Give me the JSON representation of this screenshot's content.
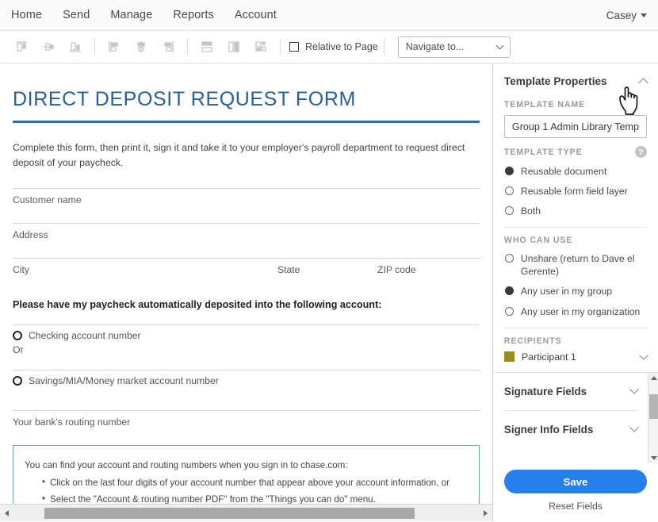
{
  "topnav": {
    "items": [
      {
        "label": "Home"
      },
      {
        "label": "Send"
      },
      {
        "label": "Manage"
      },
      {
        "label": "Reports"
      },
      {
        "label": "Account"
      }
    ],
    "user": "Casey"
  },
  "toolbar": {
    "icons": [
      {
        "name": "align-top-icon"
      },
      {
        "name": "align-middle-horizontal-icon"
      },
      {
        "name": "align-bottom-icon"
      },
      {
        "name": "align-left-icon"
      },
      {
        "name": "align-center-icon"
      },
      {
        "name": "align-right-icon"
      },
      {
        "name": "match-width-icon"
      },
      {
        "name": "match-height-icon"
      },
      {
        "name": "match-width-and-height-icon"
      }
    ],
    "relative_to_page_label": "Relative to Page",
    "relative_to_page_checked": false,
    "navigate_to_label": "Navigate to..."
  },
  "document": {
    "title": "DIRECT DEPOSIT REQUEST FORM",
    "intro": "Complete this form, then print it, sign it and take it to your employer's payroll department to request direct deposit of your paycheck.",
    "fields": [
      {
        "label": "Customer name"
      },
      {
        "label": "Address"
      }
    ],
    "address_row": [
      {
        "label": "City"
      },
      {
        "label": "State"
      },
      {
        "label": "ZIP code"
      }
    ],
    "section_heading": "Please have my paycheck automatically deposited into the following account:",
    "option_checking": "Checking account number",
    "or_text": "Or",
    "option_savings": "Savings/MIA/Money market account number",
    "routing_label": "Your bank's routing number",
    "infobox": {
      "lead": "You can find your account and routing numbers when you sign in to chase.com:",
      "bullets": [
        "Click on the last four digits of your account number that appear above your account information, or",
        "Select the \"Account & routing number PDF\" from the \"Things you can do\" menu."
      ]
    }
  },
  "panel": {
    "title": "Template Properties",
    "template_name_label": "TEMPLATE NAME",
    "template_name_value": "Group 1 Admin Library Temp",
    "template_type_label": "TEMPLATE TYPE",
    "template_type_options": [
      {
        "label": "Reusable document",
        "selected": true
      },
      {
        "label": "Reusable form field layer",
        "selected": false
      },
      {
        "label": "Both",
        "selected": false
      }
    ],
    "who_can_use_label": "WHO CAN USE",
    "who_can_use_options": [
      {
        "label": "Unshare (return to Dave el Gerente)",
        "selected": false
      },
      {
        "label": "Any user in my group",
        "selected": true
      },
      {
        "label": "Any user in my organization",
        "selected": false
      }
    ],
    "recipients_label": "RECIPIENTS",
    "recipient_name": "Participant 1",
    "recipient_color": "#9a8b1a",
    "field_sections": [
      {
        "label": "Signature Fields"
      },
      {
        "label": "Signer Info Fields"
      }
    ],
    "save_label": "Save",
    "reset_label": "Reset Fields",
    "help_glyph": "?",
    "accent_color": "#2680eb"
  }
}
